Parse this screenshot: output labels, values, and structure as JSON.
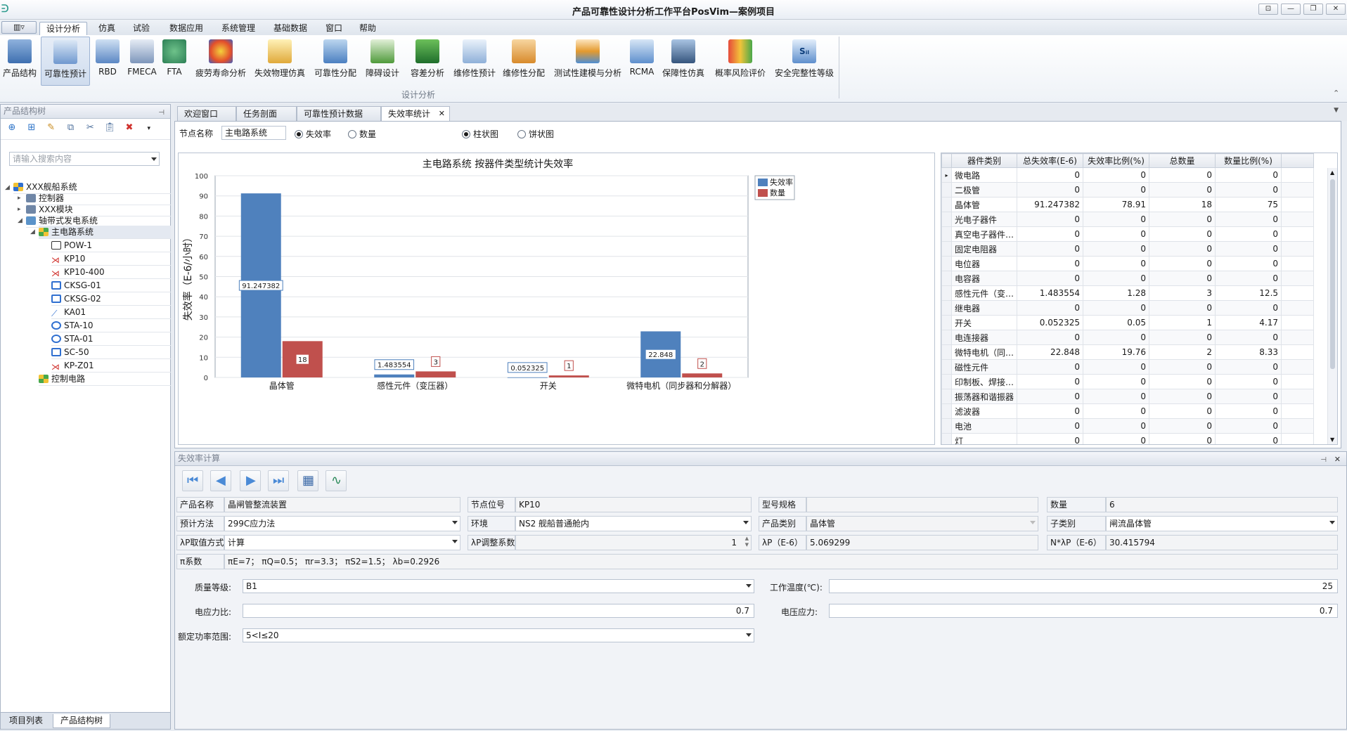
{
  "window": {
    "title": "产品可靠性设计分析工作平台PosVim—案例项目",
    "app_button": "▥▿"
  },
  "ribbon_tabs": [
    "设计分析",
    "仿真",
    "试验",
    "数据应用",
    "系统管理",
    "基础数据",
    "窗口",
    "帮助"
  ],
  "ribbon_buttons": [
    "产品结构",
    "可靠性预计",
    "RBD",
    "FMECA",
    "FTA",
    "疲劳寿命分析",
    "失效物理仿真",
    "可靠性分配",
    "障碍设计",
    "容差分析",
    "维修性预计",
    "维修性分配",
    "测试性建模与分析",
    "RCMA",
    "保障性仿真",
    "概率风险评价",
    "安全完整性等级"
  ],
  "ribbon_group_label": "设计分析",
  "left_panel": {
    "title": "产品结构树",
    "search_placeholder": "请输入搜索内容",
    "tree": [
      {
        "label": "XXX舰船系统"
      },
      {
        "label": "控制器"
      },
      {
        "label": "XXX模块"
      },
      {
        "label": "轴带式发电系统"
      },
      {
        "label": "主电路系统"
      },
      {
        "label": "POW-1"
      },
      {
        "label": "KP10"
      },
      {
        "label": "KP10-400"
      },
      {
        "label": "CKSG-01"
      },
      {
        "label": "CKSG-02"
      },
      {
        "label": "KA01"
      },
      {
        "label": "STA-10"
      },
      {
        "label": "STA-01"
      },
      {
        "label": "SC-50"
      },
      {
        "label": "KP-Z01"
      },
      {
        "label": "控制电路"
      }
    ],
    "bottom_tabs": [
      "项目列表",
      "产品结构树"
    ]
  },
  "doc_tabs": [
    "欢迎窗口",
    "任务剖面",
    "可靠性预计数据",
    "失效率统计"
  ],
  "filters": {
    "node_label": "节点名称",
    "node_value": "主电路系统",
    "radio_failure_rate": "失效率",
    "radio_count": "数量",
    "radio_bar": "柱状图",
    "radio_pie": "饼状图"
  },
  "chart_data": {
    "type": "bar",
    "title": "主电路系统  按器件类型统计失效率",
    "ylabel": "失效率（E-6/小时）",
    "xlabel": "",
    "ylim": [
      0,
      100
    ],
    "yticks": [
      0,
      10,
      20,
      30,
      40,
      50,
      60,
      70,
      80,
      90,
      100
    ],
    "categories": [
      "晶体管",
      "感性元件（变压器）",
      "开关",
      "微特电机（同步器和分解器）"
    ],
    "series": [
      {
        "name": "失效率",
        "color": "#4f81bd",
        "values": [
          91.247382,
          1.483554,
          0.052325,
          22.848
        ],
        "labels": [
          "91.247382",
          "1.483554",
          "0.052325",
          "22.848"
        ]
      },
      {
        "name": "数量",
        "color": "#c0504d",
        "values": [
          18,
          3,
          1,
          2
        ],
        "labels": [
          "18",
          "3",
          "1",
          "2"
        ]
      }
    ],
    "legend": "top-right",
    "grid": true
  },
  "grid": {
    "headers": [
      "器件类别",
      "总失效率(E-6)",
      "失效率比例(%)",
      "总数量",
      "数量比例(%)"
    ],
    "rows": [
      [
        "微电路",
        "0",
        "0",
        "0",
        "0"
      ],
      [
        "二极管",
        "0",
        "0",
        "0",
        "0"
      ],
      [
        "晶体管",
        "91.247382",
        "78.91",
        "18",
        "75"
      ],
      [
        "光电子器件",
        "0",
        "0",
        "0",
        "0"
      ],
      [
        "真空电子器件…",
        "0",
        "0",
        "0",
        "0"
      ],
      [
        "固定电阻器",
        "0",
        "0",
        "0",
        "0"
      ],
      [
        "电位器",
        "0",
        "0",
        "0",
        "0"
      ],
      [
        "电容器",
        "0",
        "0",
        "0",
        "0"
      ],
      [
        "感性元件（变…",
        "1.483554",
        "1.28",
        "3",
        "12.5"
      ],
      [
        "继电器",
        "0",
        "0",
        "0",
        "0"
      ],
      [
        "开关",
        "0.052325",
        "0.05",
        "1",
        "4.17"
      ],
      [
        "电连接器",
        "0",
        "0",
        "0",
        "0"
      ],
      [
        "微特电机（同…",
        "22.848",
        "19.76",
        "2",
        "8.33"
      ],
      [
        "磁性元件",
        "0",
        "0",
        "0",
        "0"
      ],
      [
        "印制板、焊接…",
        "0",
        "0",
        "0",
        "0"
      ],
      [
        "振荡器和谐振器",
        "0",
        "0",
        "0",
        "0"
      ],
      [
        "滤波器",
        "0",
        "0",
        "0",
        "0"
      ],
      [
        "电池",
        "0",
        "0",
        "0",
        "0"
      ],
      [
        "灯",
        "0",
        "0",
        "0",
        "0"
      ]
    ]
  },
  "calc": {
    "title": "失效率计算",
    "product_name_label": "产品名称",
    "product_name": "晶闸管整流装置",
    "node_pos_label": "节点位号",
    "node_pos": "KP10",
    "model_label": "型号规格",
    "model": "",
    "qty_label": "数量",
    "qty": "6",
    "method_label": "预计方法",
    "method": "299C应力法",
    "env_label": "环境",
    "env": "NS2 舰船普通舱内",
    "category_label": "产品类别",
    "category": "晶体管",
    "subcat_label": "子类别",
    "subcat": "闸流晶体管",
    "lp_mode_label": "λP取值方式",
    "lp_mode": "计算",
    "lp_adj_label": "λP调整系数",
    "lp_adj": "1",
    "lp_label": "λP（E-6）",
    "lp": "5.069299",
    "nlp_label": "N*λP（E-6）",
    "nlp": "30.415794",
    "pi_label": "π系数",
    "pi": "πE=7； πQ=0.5； πr=3.3； πS2=1.5； λb=0.2926",
    "quality_label": "质量等级:",
    "quality": "B1",
    "temp_label": "工作温度(℃):",
    "temp": "25",
    "current_ratio_label": "电应力比:",
    "current_ratio": "0.7",
    "voltage_label": "电压应力:",
    "voltage": "0.7",
    "power_label": "额定功率范围:",
    "power": "5<I≤20"
  }
}
